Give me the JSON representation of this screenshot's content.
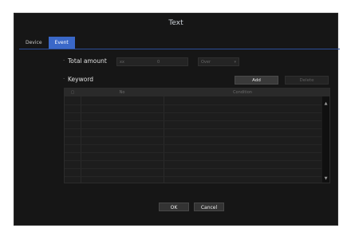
{
  "dialog": {
    "title": "Text"
  },
  "tabs": [
    {
      "label": "Device",
      "active": false
    },
    {
      "label": "Event",
      "active": true
    }
  ],
  "total_amount": {
    "label": "Total amount",
    "prefix": "xx",
    "value": "0",
    "mode": "Over"
  },
  "keyword": {
    "label": "Keyword",
    "add_label": "Add",
    "delete_label": "Delete"
  },
  "table": {
    "columns": [
      "No",
      "Condition"
    ]
  },
  "footer": {
    "ok_label": "OK",
    "cancel_label": "Cancel"
  },
  "colors": {
    "accent": "#3a68c8",
    "background": "#161616"
  }
}
